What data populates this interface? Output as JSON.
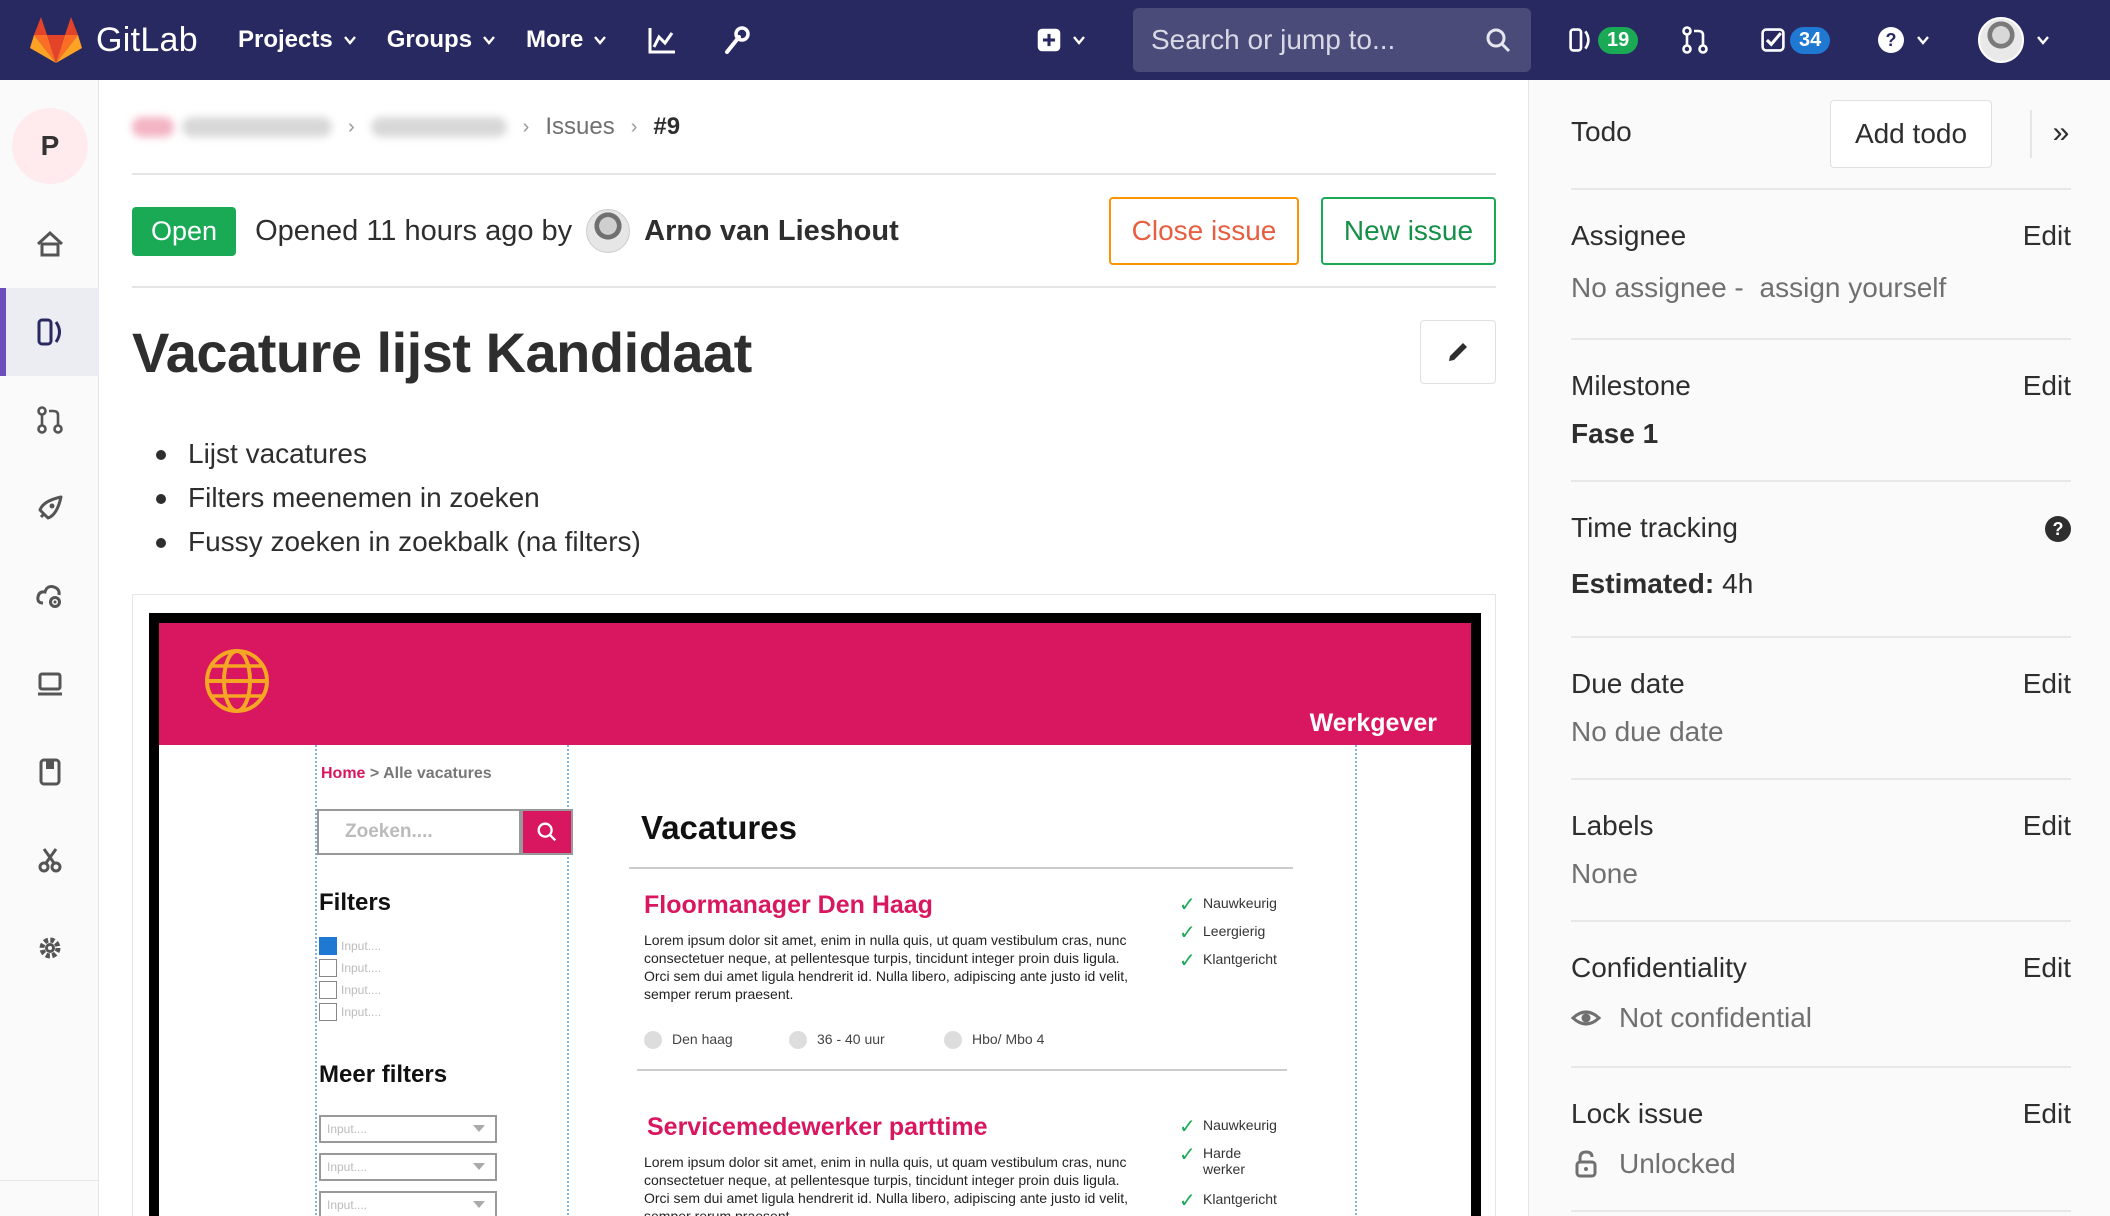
{
  "navbar": {
    "brand": "GitLab",
    "menu": [
      {
        "label": "Projects"
      },
      {
        "label": "Groups"
      },
      {
        "label": "More"
      }
    ],
    "search_placeholder": "Search or jump to...",
    "issues_count": "19",
    "todos_count": "34",
    "icons": [
      "activity-chart-icon",
      "admin-wrench-icon",
      "plus-square-icon",
      "issues-icon",
      "merge-request-icon",
      "todo-check-icon",
      "help-icon"
    ]
  },
  "sidebar": {
    "project_letter": "P",
    "items": [
      "project-home",
      "issues",
      "merge-requests",
      "ci-cd",
      "operations",
      "environments",
      "wiki",
      "snippets",
      "settings"
    ],
    "active": "issues"
  },
  "breadcrumbs": {
    "items": [
      "Issues",
      "#9"
    ]
  },
  "issue": {
    "status": "Open",
    "opened_text": "Opened 11 hours ago by",
    "author": "Arno van Lieshout",
    "close_button": "Close issue",
    "new_button": "New issue",
    "title": "Vacature lijst Kandidaat",
    "description": [
      "Lijst vacatures",
      "Filters meenemen in zoeken",
      "Fussy zoeken in zoekbalk (na filters)"
    ]
  },
  "mockup": {
    "header_color": "#d81760",
    "werkgever": "Werkgever",
    "breadcrumb_home": "Home",
    "breadcrumb_rest": "> Alle vacatures",
    "search_placeholder": "Zoeken....",
    "filters_heading": "Filters",
    "filter_inputs": [
      "Input....",
      "Input....",
      "Input....",
      "Input...."
    ],
    "more_filters_heading": "Meer filters",
    "more_filter_selects": [
      "Input....",
      "Input....",
      "Input...."
    ],
    "page_title": "Vacatures",
    "jobs": [
      {
        "title": "Floormanager Den Haag",
        "lorem": "Lorem ipsum dolor sit amet, enim in nulla quis, ut quam vestibulum cras, nunc consectetuer neque, at pellentesque turpis, tincidunt integer proin duis ligula. Orci sem dui amet ligula hendrerit id. Nulla libero, adipiscing ante justo id velit, semper rerum praesent.",
        "tags": [
          "Nauwkeurig",
          "Leergierig",
          "Klantgericht"
        ],
        "meta": [
          "Den haag",
          "36 - 40 uur",
          "Hbo/ Mbo 4"
        ]
      },
      {
        "title": "Servicemedewerker parttime",
        "lorem": "Lorem ipsum dolor sit amet, enim in nulla quis, ut quam vestibulum cras, nunc consectetuer neque, at pellentesque turpis, tincidunt integer proin duis ligula. Orci sem dui amet ligula hendrerit id. Nulla libero, adipiscing ante justo id velit, semper rerum praesent.",
        "tags": [
          "Nauwkeurig",
          "Harde werker",
          "Klantgericht"
        ]
      }
    ]
  },
  "right_sidebar": {
    "todo_label": "Todo",
    "add_todo": "Add todo",
    "collapse": "»",
    "assignee": {
      "label": "Assignee",
      "edit": "Edit",
      "value": "No assignee - ",
      "link": "assign yourself"
    },
    "milestone": {
      "label": "Milestone",
      "edit": "Edit",
      "value": "Fase 1"
    },
    "time_tracking": {
      "label": "Time tracking",
      "estimated_label": "Estimated:",
      "estimated_value": "4h"
    },
    "due_date": {
      "label": "Due date",
      "edit": "Edit",
      "value": "No due date"
    },
    "labels": {
      "label": "Labels",
      "edit": "Edit",
      "value": "None"
    },
    "confidentiality": {
      "label": "Confidentiality",
      "edit": "Edit",
      "value": "Not confidential"
    },
    "lock": {
      "label": "Lock issue",
      "edit": "Edit",
      "value": "Unlocked"
    }
  }
}
